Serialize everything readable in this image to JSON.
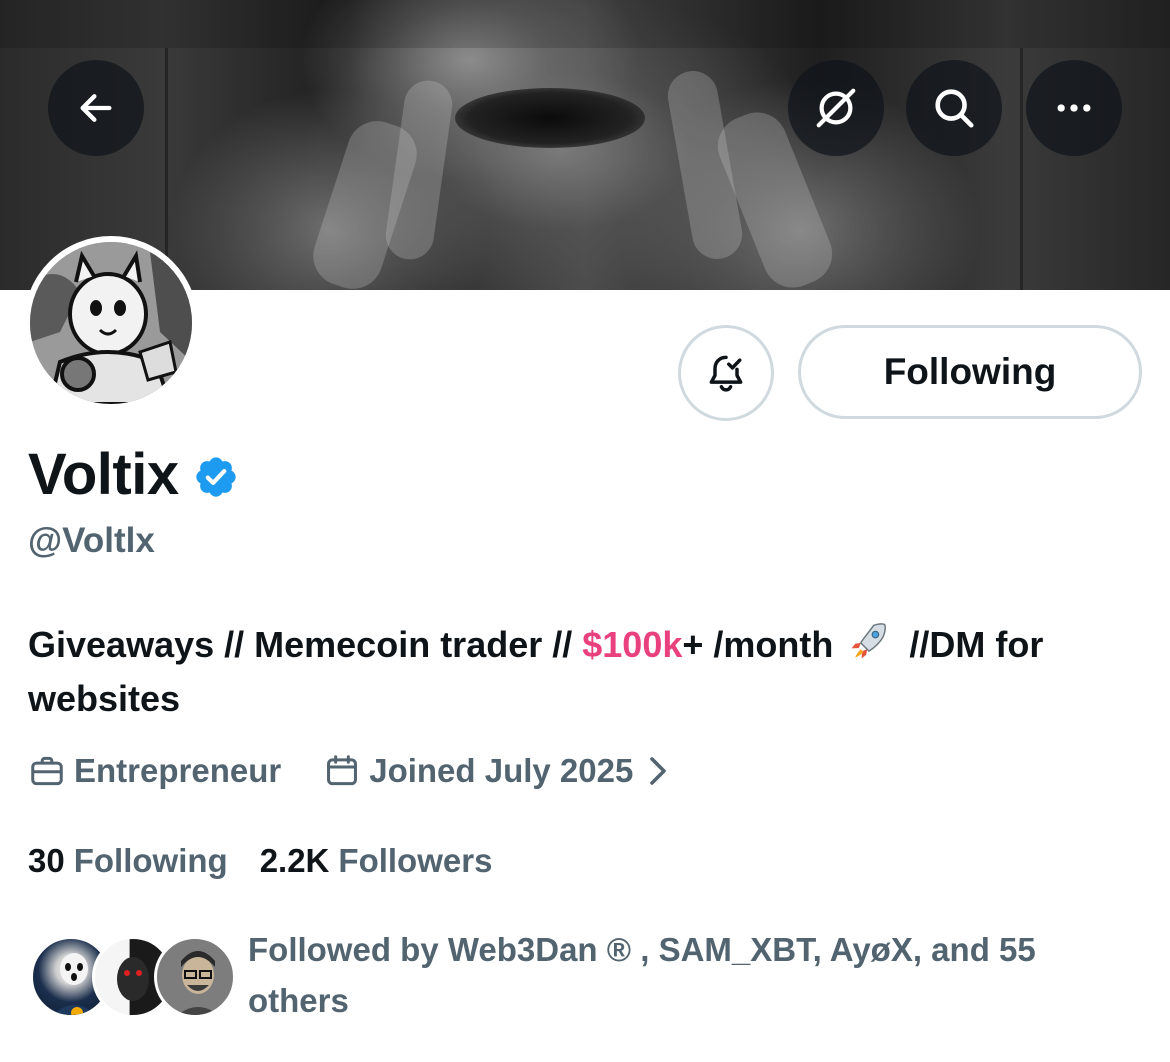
{
  "header": {
    "back_icon": "arrow-left-icon",
    "grok_icon": "grok-icon",
    "search_icon": "search-icon",
    "more_icon": "more-horizontal-icon"
  },
  "profile": {
    "display_name": "Voltix",
    "handle": "@Voltlx",
    "verified": true,
    "bio_part1": "Giveaways // Memecoin trader // ",
    "bio_money": "$100k",
    "bio_part2": "+ /month ",
    "bio_part3": " //DM for websites",
    "profession": "Entrepreneur",
    "joined": "Joined July 2025"
  },
  "actions": {
    "notify_icon": "bell-check-icon",
    "following_label": "Following"
  },
  "stats": {
    "following_count": "30",
    "following_label": "Following",
    "followers_count": "2.2K",
    "followers_label": "Followers"
  },
  "followed_by": {
    "text": "Followed by Web3Dan ® , SAM_XBT, AyøX, and 55 others"
  },
  "colors": {
    "accent_pink": "#e8417d",
    "verified_blue": "#1d9bf0",
    "secondary_text": "#536471",
    "border": "#cfd9de"
  }
}
